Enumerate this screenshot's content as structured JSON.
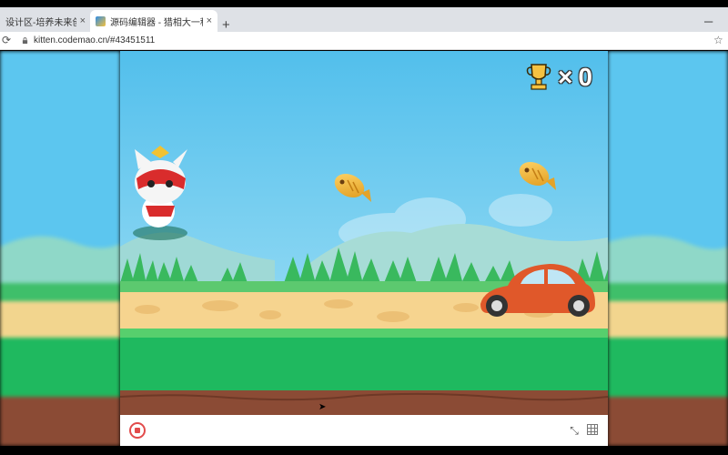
{
  "browser": {
    "tabs": [
      {
        "title": "设计区-培养未来创作者 - 首",
        "active": false,
        "close": "×"
      },
      {
        "title": "源码编辑器 - 猎相大一程有趣的",
        "active": true,
        "close": "×"
      }
    ],
    "new_tab": "+",
    "minimize": "─",
    "url": "kitten.codemao.cn/#43451511",
    "reload_icon": "reload-icon",
    "star_icon": "bookmark-star-icon"
  },
  "game": {
    "score_prefix": "×",
    "score": "0",
    "sprites": [
      "hero-cat",
      "golden-fish",
      "golden-fish",
      "orange-car",
      "trophy"
    ],
    "colors": {
      "sky": "#56c3ec",
      "grass": "#1fb95f",
      "path": "#f6d48f",
      "dirt": "#8b4b35"
    }
  },
  "controls": {
    "stop_icon": "stop-icon",
    "collapse_icon": "collapse-icon",
    "grid_icon": "grid-icon",
    "collapse_glyph": "⤡"
  }
}
